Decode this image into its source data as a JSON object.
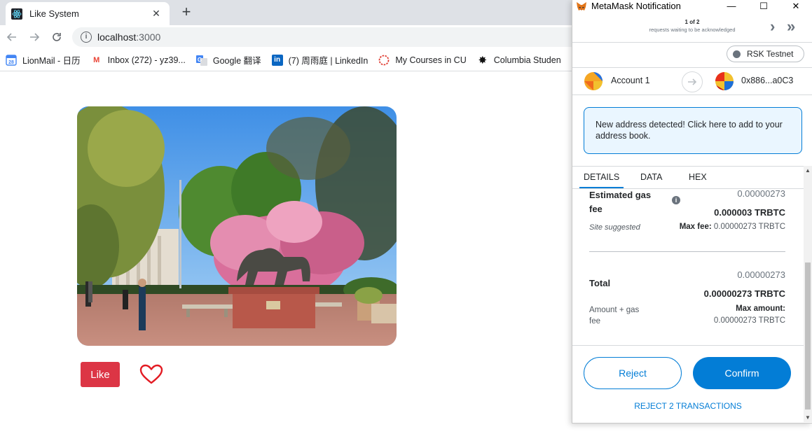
{
  "browser": {
    "tab_title": "Like System",
    "close_symbol": "✕",
    "new_tab_symbol": "+",
    "url_host": "localhost",
    "url_port": ":3000",
    "info_symbol": "i",
    "bookmarks": [
      {
        "label": "LionMail - 日历",
        "icon": "calendar-icon",
        "badge": "28"
      },
      {
        "label": "Inbox (272) - yz39...",
        "icon": "gmail-icon",
        "badge": "M"
      },
      {
        "label": "Google 翻译",
        "icon": "translate-icon",
        "badge": "G"
      },
      {
        "label": "(7) 周雨庭 | LinkedIn",
        "icon": "linkedin-icon",
        "badge": "in"
      },
      {
        "label": "My Courses in CU",
        "icon": "courses-icon",
        "badge": ""
      },
      {
        "label": "Columbia Studen",
        "icon": "columbia-icon",
        "badge": "✸"
      }
    ]
  },
  "page": {
    "like_label": "Like",
    "photo_icon": "campus-photo"
  },
  "metamask": {
    "window_title": "MetaMask Notification",
    "win_min": "—",
    "win_max": "☐",
    "win_close": "✕",
    "queue_count": "1 of 2",
    "queue_text": "requests waiting to be acknowledged",
    "queue_next": "›",
    "queue_last": "»",
    "network": "RSK Testnet",
    "from_account": "Account 1",
    "to_address": "0x886...a0C3",
    "alert_text": "New address detected! Click here to add to your address book.",
    "tabs": [
      "DETAILS",
      "DATA",
      "HEX"
    ],
    "gas": {
      "label": "Estimated gas fee",
      "info": "i",
      "fiat": "0.00000273",
      "crypto": "0.000003 TRBTC",
      "site_suggested": "Site suggested",
      "max_fee_label": "Max fee:",
      "max_fee_value": "0.00000273 TRBTC"
    },
    "total": {
      "label": "Total",
      "fiat": "0.00000273",
      "crypto": "0.00000273 TRBTC",
      "amount_gas": "Amount + gas fee",
      "max_amount_label": "Max amount:",
      "max_amount_value": "0.00000273 TRBTC"
    },
    "reject_label": "Reject",
    "confirm_label": "Confirm",
    "reject_all_label": "REJECT 2 TRANSACTIONS",
    "scroll_up": "▲",
    "scroll_down": "▼",
    "colors": {
      "primary": "#037dd6",
      "alert_bg": "#eaf6ff",
      "like_red": "#dc3545"
    }
  }
}
